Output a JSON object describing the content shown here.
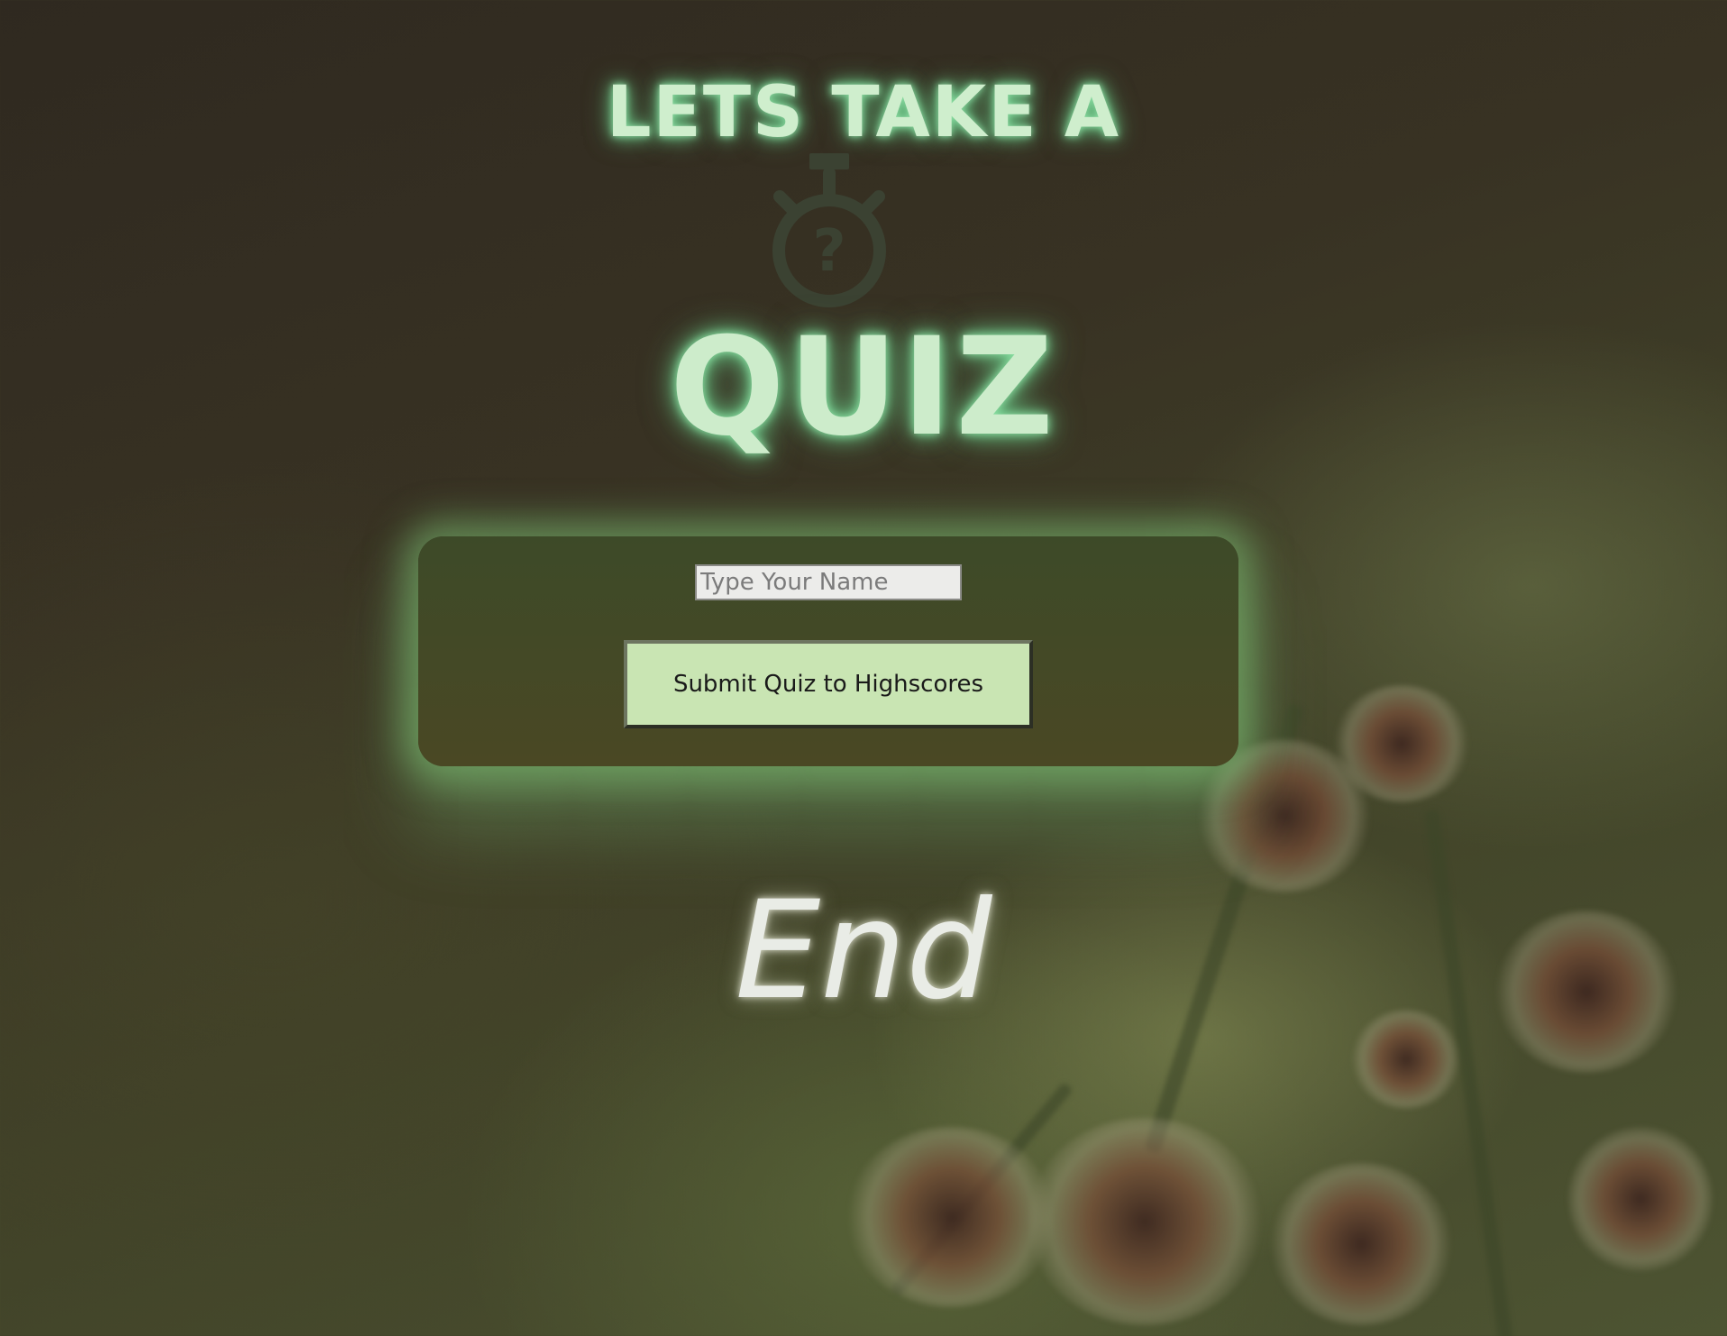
{
  "logo": {
    "top_text": "LETS TAKE A",
    "icon": "stopwatch-question-icon",
    "bottom_text": "QUIZ"
  },
  "form": {
    "name_placeholder": "Type Your Name",
    "name_value": "",
    "submit_label": "Submit Quiz to Highscores"
  },
  "end_heading": "End",
  "colors": {
    "glow": "#8fe0a6",
    "card": "#3f4a27",
    "button": "#c9e5b3"
  }
}
